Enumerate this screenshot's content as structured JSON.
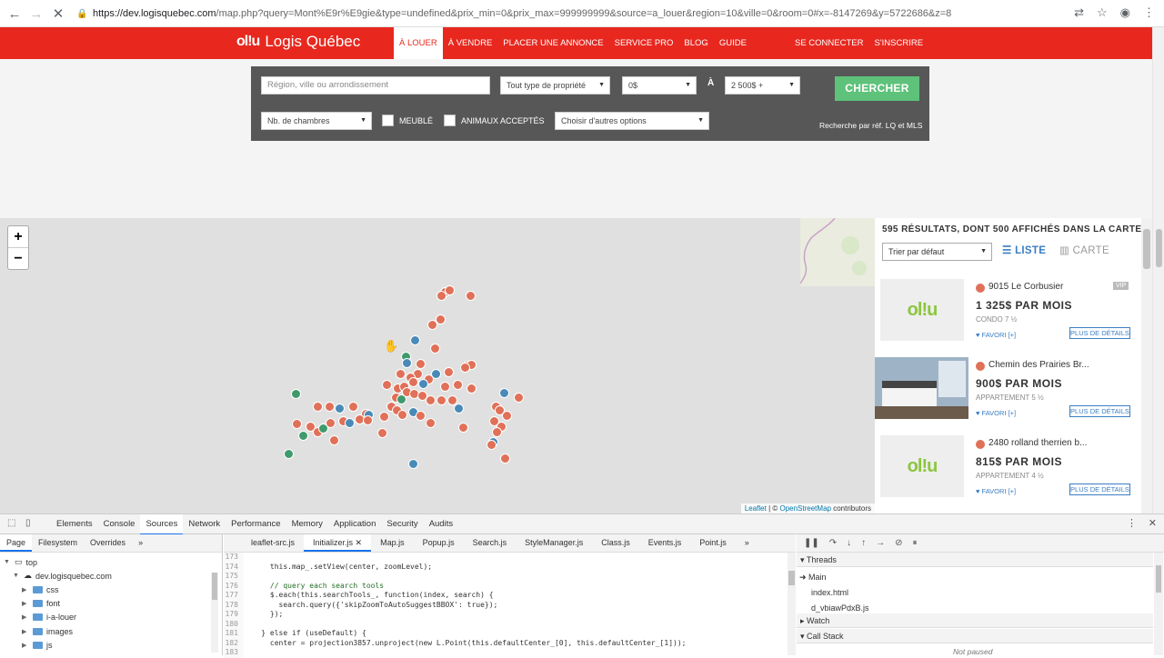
{
  "browser": {
    "url_host": "https://dev.logisquebec.com",
    "url_rest": "/map.php?query=Mont%E9r%E9gie&type=undefined&prix_min=0&prix_max=999999999&source=a_louer&region=10&ville=0&room=0#x=-8147269&y=5722686&z=8"
  },
  "header": {
    "logo_mark": "ol!u",
    "logo_text": "Logis Québec",
    "nav": [
      "À LOUER",
      "À VENDRE",
      "PLACER UNE ANNONCE",
      "SERVICE PRO",
      "BLOG",
      "GUIDE"
    ],
    "auth": [
      "SE CONNECTER",
      "S'INSCRIRE"
    ]
  },
  "search": {
    "location_placeholder": "Région, ville ou arrondissement",
    "property_type": "Tout type de propriété",
    "price_min": "0$",
    "to_label": "À",
    "price_max": "2 500$ +",
    "bedrooms": "Nb. de chambres",
    "furnished": "MEUBLÉ",
    "pets": "ANIMAUX ACCEPTÉS",
    "other_options": "Choisir d'autres options",
    "search_button": "CHERCHER",
    "ref_link": "Recherche par réf. LQ et MLS"
  },
  "map": {
    "zoom_in": "+",
    "zoom_out": "−",
    "attrib_leaflet": "Leaflet",
    "attrib_sep": " | © ",
    "attrib_osm": "OpenStreetMap",
    "attrib_rest": " contributors",
    "marker_colors": {
      "red": "#e07058",
      "blue": "#4a8ab8",
      "green": "#3f9a6c"
    }
  },
  "results": {
    "count_text": "595 RÉSULTATS, DONT 500 AFFICHÉS DANS LA CARTE.",
    "sort": "Trier par défaut",
    "view_list": "LISTE",
    "view_map": "CARTE",
    "listings": [
      {
        "title": "9015 Le Corbusier",
        "badge": "VIP",
        "price": "1 325$ PAR MOIS",
        "type": "CONDO 7 ½",
        "fav": "FAVORI [+]",
        "details": "PLUS DE DÉTAILS",
        "image": "logo"
      },
      {
        "title": "Chemin des Prairies Br...",
        "badge": "",
        "price": "900$ PAR MOIS",
        "type": "APPARTEMENT 5 ½",
        "fav": "FAVORI [+]",
        "details": "PLUS DE DÉTAILS",
        "image": "photo"
      },
      {
        "title": "2480 rolland therrien b...",
        "badge": "",
        "price": "815$ PAR MOIS",
        "type": "APPARTEMENT 4 ½",
        "fav": "FAVORI [+]",
        "details": "PLUS DE DÉTAILS",
        "image": "logo"
      }
    ]
  },
  "devtools": {
    "tabs": [
      "Elements",
      "Console",
      "Sources",
      "Network",
      "Performance",
      "Memory",
      "Application",
      "Security",
      "Audits"
    ],
    "active_tab": "Sources",
    "nav_tabs": [
      "Page",
      "Filesystem",
      "Overrides"
    ],
    "tree": [
      {
        "label": "top",
        "depth": 0
      },
      {
        "label": "dev.logisquebec.com",
        "depth": 1
      },
      {
        "label": "css",
        "depth": 2
      },
      {
        "label": "font",
        "depth": 2
      },
      {
        "label": "i-a-louer",
        "depth": 2
      },
      {
        "label": "images",
        "depth": 2
      },
      {
        "label": "js",
        "depth": 2
      }
    ],
    "files": [
      "leaflet-src.js",
      "Initializer.js",
      "Map.js",
      "Popup.js",
      "Search.js",
      "StyleManager.js",
      "Class.js",
      "Events.js",
      "Point.js"
    ],
    "active_file": "Initializer.js",
    "code": [
      {
        "n": "173",
        "t": ""
      },
      {
        "n": "174",
        "t": "      this.map_.setView(center, zoomLevel);"
      },
      {
        "n": "175",
        "t": ""
      },
      {
        "n": "176",
        "t": "      // query each search tools"
      },
      {
        "n": "177",
        "t": "      $.each(this.searchTools_, function(index, search) {"
      },
      {
        "n": "178",
        "t": "        search.query({'skipZoomToAutoSuggestBBOX': true});"
      },
      {
        "n": "179",
        "t": "      });"
      },
      {
        "n": "180",
        "t": ""
      },
      {
        "n": "181",
        "t": "    } else if (useDefault) {"
      },
      {
        "n": "182",
        "t": "      center = projection3857.unproject(new L.Point(this.defaultCenter_[0], this.defaultCenter_[1]));"
      },
      {
        "n": "183",
        "t": ""
      }
    ],
    "threads_label": "Threads",
    "threads": [
      "Main",
      "index.html",
      "d_vbiawPdxB.js"
    ],
    "watch_label": "Watch",
    "callstack_label": "Call Stack",
    "not_paused": "Not paused"
  }
}
